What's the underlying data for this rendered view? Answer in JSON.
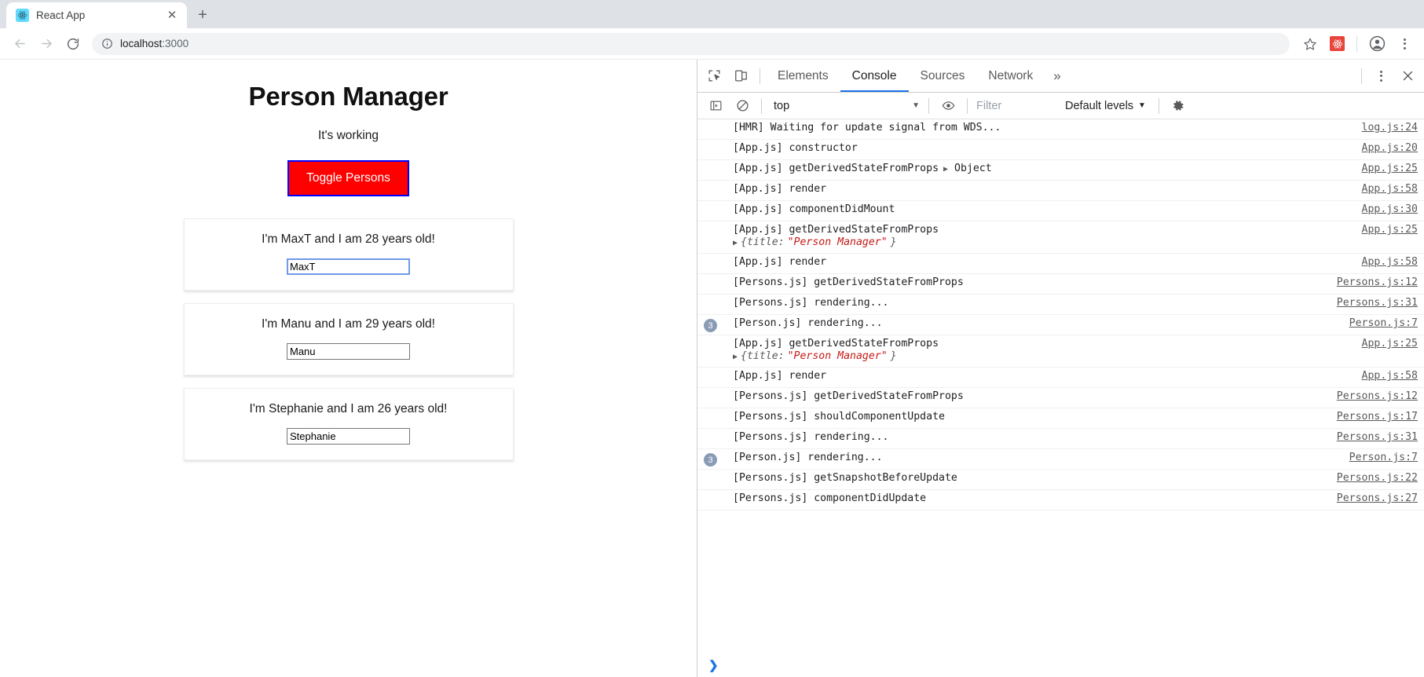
{
  "browser": {
    "tab": {
      "title": "React App",
      "favicon": "react-logo-icon",
      "close_label": "✕"
    },
    "new_tab_label": "+",
    "nav": {
      "back": "←",
      "forward": "→",
      "reload": "↻"
    },
    "address": {
      "icon": "info-circle-icon",
      "host": "localhost",
      "port": ":3000"
    },
    "actions": {
      "bookmark": "star-icon",
      "extension": "react-devtools-extension-icon",
      "profile": "profile-avatar-icon",
      "menu": "three-dot-menu-icon"
    }
  },
  "page": {
    "title": "Person Manager",
    "subtitle": "It's working",
    "toggle_button": "Toggle Persons",
    "button_colors": {
      "background": "#ff0000",
      "text": "#ffffff",
      "border": "#0000ff"
    },
    "persons": [
      {
        "text": "I'm MaxT and I am 28 years old!",
        "input_value": "MaxT",
        "focused": true
      },
      {
        "text": "I'm Manu and I am 29 years old!",
        "input_value": "Manu",
        "focused": false
      },
      {
        "text": "I'm Stephanie and I am 26 years old!",
        "input_value": "Stephanie",
        "focused": false
      }
    ]
  },
  "devtools": {
    "tabs": [
      {
        "label": "Elements",
        "active": false
      },
      {
        "label": "Console",
        "active": true
      },
      {
        "label": "Sources",
        "active": false
      },
      {
        "label": "Network",
        "active": false
      }
    ],
    "overflow_label": "»",
    "icons": {
      "inspect": "inspect-element-icon",
      "device": "device-toolbar-icon",
      "more": "devtools-more-options-icon",
      "close": "devtools-close-icon"
    },
    "console_toolbar": {
      "sidebar_toggle": "console-sidebar-icon",
      "clear": "clear-console-icon",
      "context": "top",
      "context_caret": "▼",
      "eye": "live-expression-icon",
      "filter_placeholder": "Filter",
      "filter_value": "",
      "levels": "Default levels",
      "levels_caret": "▼",
      "settings": "settings-gear-icon"
    },
    "logs": [
      {
        "count": "",
        "message": "[HMR] Waiting for update signal from WDS...",
        "source": "log.js:24"
      },
      {
        "count": "",
        "message": "[App.js] constructor",
        "source": "App.js:20"
      },
      {
        "count": "",
        "message": "[App.js] getDerivedStateFromProps",
        "inline_object": "Object",
        "source": "App.js:25"
      },
      {
        "count": "",
        "message": "[App.js] render",
        "source": "App.js:58"
      },
      {
        "count": "",
        "message": "[App.js] componentDidMount",
        "source": "App.js:30"
      },
      {
        "count": "",
        "message": "[App.js] getDerivedStateFromProps",
        "object_key": "title:",
        "object_value": "\"Person Manager\"",
        "source": "App.js:25"
      },
      {
        "count": "",
        "message": "[App.js] render",
        "source": "App.js:58"
      },
      {
        "count": "",
        "message": "[Persons.js] getDerivedStateFromProps",
        "source": "Persons.js:12"
      },
      {
        "count": "",
        "message": "[Persons.js] rendering...",
        "source": "Persons.js:31"
      },
      {
        "count": "3",
        "message": "[Person.js] rendering...",
        "source": "Person.js:7"
      },
      {
        "count": "",
        "message": "[App.js] getDerivedStateFromProps",
        "object_key": "title:",
        "object_value": "\"Person Manager\"",
        "source": "App.js:25"
      },
      {
        "count": "",
        "message": "[App.js] render",
        "source": "App.js:58"
      },
      {
        "count": "",
        "message": "[Persons.js] getDerivedStateFromProps",
        "source": "Persons.js:12"
      },
      {
        "count": "",
        "message": "[Persons.js] shouldComponentUpdate",
        "source": "Persons.js:17"
      },
      {
        "count": "",
        "message": "[Persons.js] rendering...",
        "source": "Persons.js:31"
      },
      {
        "count": "3",
        "message": "[Person.js] rendering...",
        "source": "Person.js:7"
      },
      {
        "count": "",
        "message": "[Persons.js] getSnapshotBeforeUpdate",
        "source": "Persons.js:22"
      },
      {
        "count": "",
        "message": "[Persons.js] componentDidUpdate",
        "source": "Persons.js:27"
      }
    ],
    "prompt": "❯"
  }
}
